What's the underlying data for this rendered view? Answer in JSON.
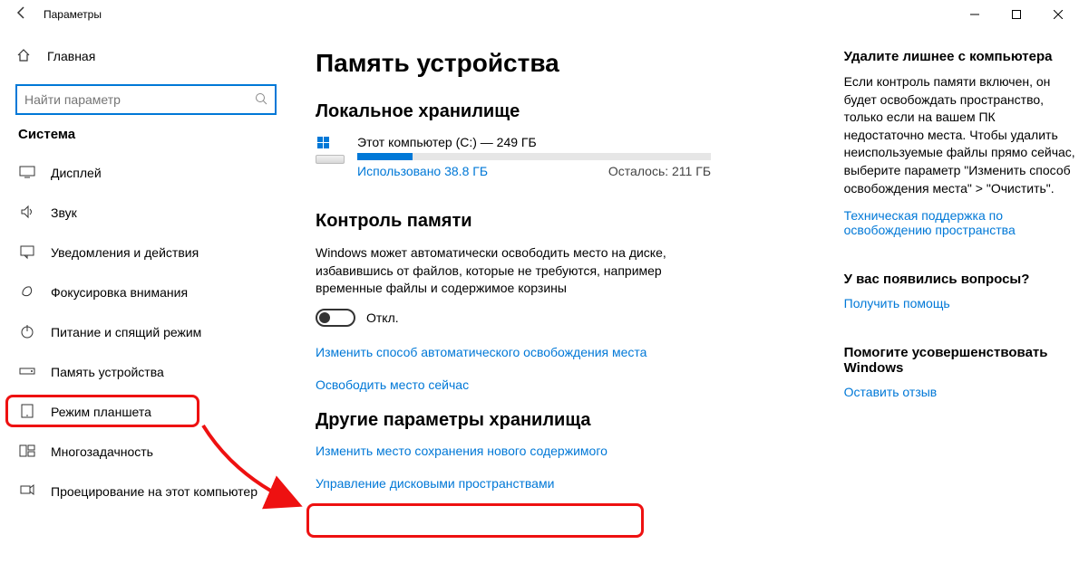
{
  "titlebar": {
    "title": "Параметры"
  },
  "sidebar": {
    "home": "Главная",
    "search_placeholder": "Найти параметр",
    "group": "Система",
    "items": [
      {
        "label": "Дисплей"
      },
      {
        "label": "Звук"
      },
      {
        "label": "Уведомления и действия"
      },
      {
        "label": "Фокусировка внимания"
      },
      {
        "label": "Питание и спящий режим"
      },
      {
        "label": "Память устройства"
      },
      {
        "label": "Режим планшета"
      },
      {
        "label": "Многозадачность"
      },
      {
        "label": "Проецирование на этот компьютер"
      }
    ]
  },
  "main": {
    "heading": "Память устройства",
    "local_storage": "Локальное хранилище",
    "drive_name": "Этот компьютер (C:) — 249 ГБ",
    "used_label": "Использовано 38.8 ГБ",
    "free_label": "Осталось: 211 ГБ",
    "used_pct": 15.6,
    "sense_heading": "Контроль памяти",
    "sense_desc": "Windows может автоматически освободить место на диске, избавившись от файлов, которые не требуются, например временные файлы и содержимое корзины",
    "toggle_label": "Откл.",
    "link_change_auto": "Изменить способ автоматического освобождения места",
    "link_free_now": "Освободить место сейчас",
    "other_heading": "Другие параметры хранилища",
    "link_change_location": "Изменить место сохранения нового содержимого",
    "link_manage_spaces": "Управление дисковыми пространствами"
  },
  "right": {
    "r1_title": "Удалите лишнее с компьютера",
    "r1_desc": "Если контроль памяти включен, он будет освобождать пространство, только если на вашем ПК недостаточно места. Чтобы удалить неиспользуемые файлы прямо сейчас, выберите параметр \"Изменить способ освобождения места\" > \"Очистить\".",
    "r1_link": "Техническая поддержка по освобождению пространства",
    "r2_title": "У вас появились вопросы?",
    "r2_link": "Получить помощь",
    "r3_title": "Помогите усовершенствовать Windows",
    "r3_link": "Оставить отзыв"
  }
}
